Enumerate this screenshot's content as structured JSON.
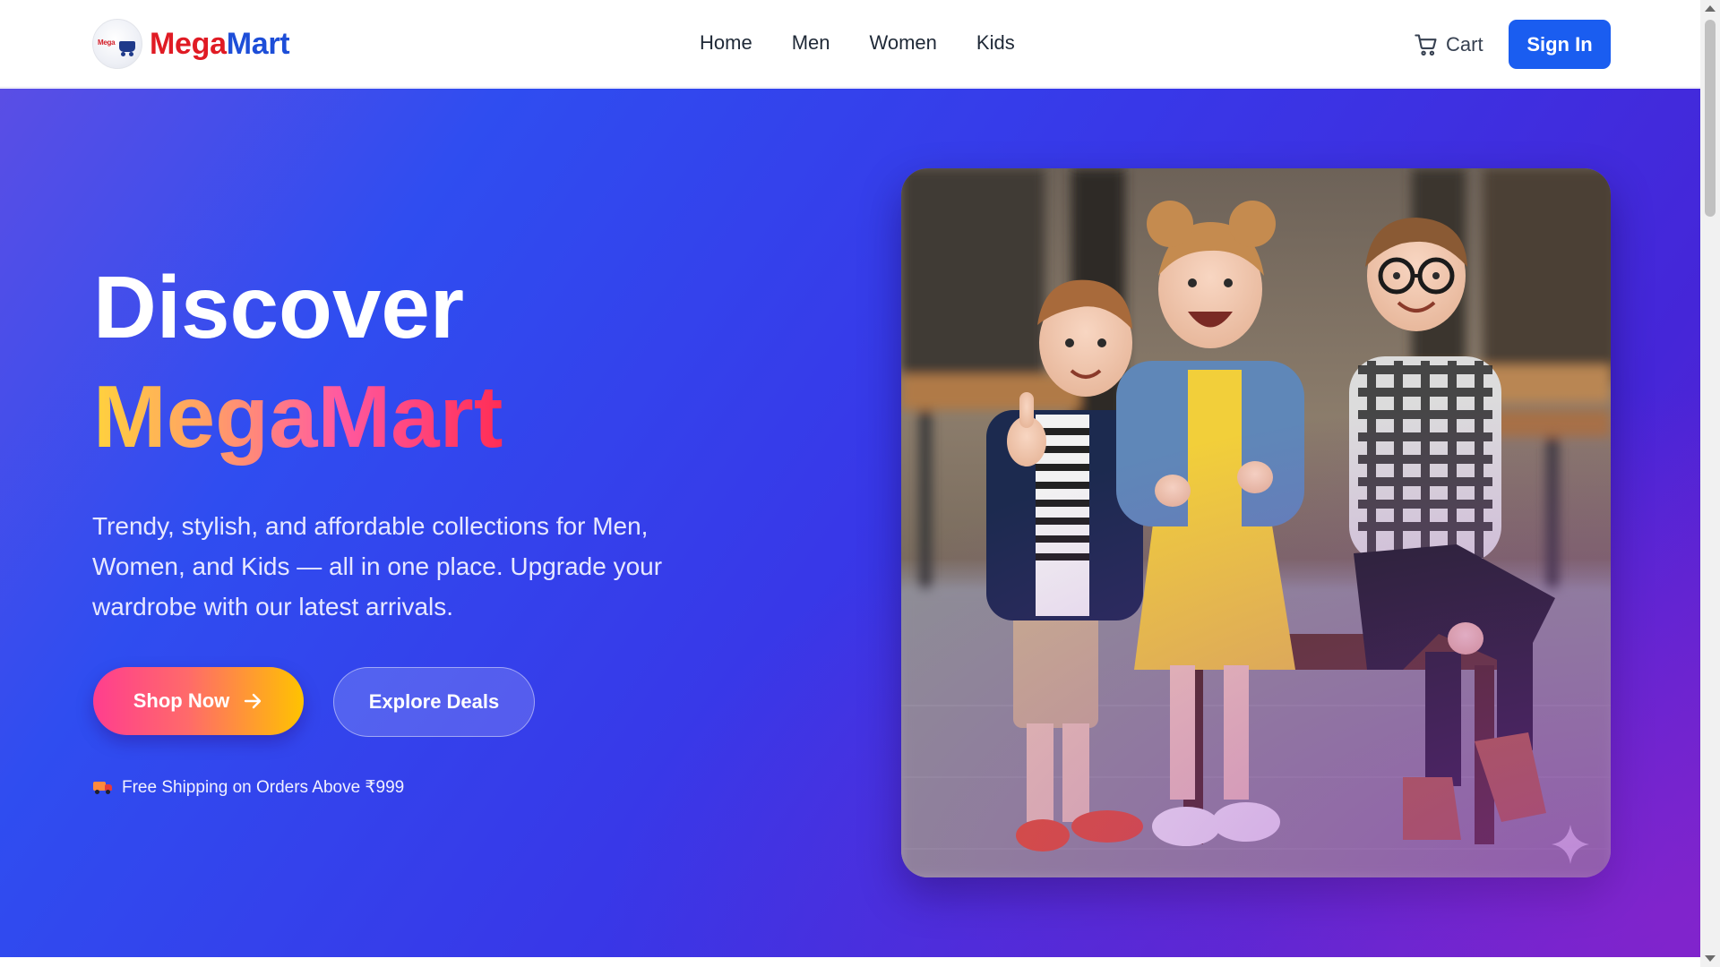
{
  "brand": {
    "mini_label": "Mega",
    "name_part1": "Mega",
    "name_part2": "Mart",
    "colors": {
      "mega": "#e01b24",
      "mart": "#1d4ed8"
    }
  },
  "nav": {
    "items": [
      {
        "label": "Home"
      },
      {
        "label": "Men"
      },
      {
        "label": "Women"
      },
      {
        "label": "Kids"
      }
    ],
    "cart_label": "Cart",
    "cart_icon": "shopping-cart-icon",
    "signin_label": "Sign In"
  },
  "hero": {
    "headline_line1": "Discover",
    "headline_line2": "MegaMart",
    "subtitle": "Trendy, stylish, and affordable collections for Men, Women, and Kids — all in one place. Upgrade your wardrobe with our latest arrivals.",
    "primary_cta": "Shop Now",
    "primary_cta_icon": "arrow-right-icon",
    "secondary_cta": "Explore Deals",
    "shipping_icon": "delivery-truck-icon",
    "shipping_note": "Free Shipping on Orders Above ₹999",
    "image_icon": "sparkle-icon",
    "colors": {
      "gradient_start": "#5a4ee5",
      "gradient_mid": "#3838e8",
      "gradient_end": "#6b1fd0",
      "primary_button": "#1a5df0"
    }
  }
}
